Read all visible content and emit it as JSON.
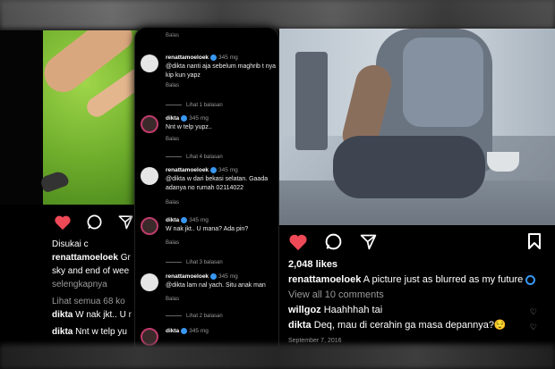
{
  "left_post": {
    "likes_prefix": "Disukai c",
    "caption_user": "renattamoeloek",
    "caption_text": "Gr",
    "caption_line2": "sky and end of wee",
    "caption_line3": "selengkapnya",
    "view_all": "Lihat semua 68 ko",
    "comments": [
      {
        "user": "dikta",
        "text": "W nak jkt.. U r"
      },
      {
        "user": "dikta",
        "text": "Nnt w telp yu"
      }
    ]
  },
  "comment_thread": {
    "top_reply": "Balas",
    "items": [
      {
        "user": "renattamoeloek",
        "time": "345 mg",
        "text": "@dikta nanti aja sebelum maghrib t nya kip kun yapz",
        "reply": "Balas",
        "avatar": "light"
      },
      {
        "user": "dikta",
        "time": "345 mg",
        "text": "Nnt w telp yupz..",
        "reply": "Balas",
        "avatar": "ring"
      },
      {
        "user": "renattamoeloek",
        "time": "345 mg",
        "text": "@dikta w dari bekasi selatan. Gaada adanya no rumah 02114022",
        "reply": "Balas",
        "avatar": "light"
      },
      {
        "user": "dikta",
        "time": "345 mg",
        "text": "W nak jkt.. U mana? Ada pin?",
        "reply": "Balas",
        "avatar": "ring"
      },
      {
        "user": "renattamoeloek",
        "time": "345 mg",
        "text": "@dikta lam nal yach. Situ anak man",
        "reply": "Balas",
        "avatar": "light"
      },
      {
        "user": "dikta",
        "time": "345 mg",
        "text": "",
        "reply": "",
        "avatar": "ring"
      }
    ],
    "more_replies": [
      "Lihat 1 balasan",
      "Lihat 4 balasan",
      "Lihat 3 balasan",
      "Lihat 2 balasan"
    ]
  },
  "right_post": {
    "likes": "2,048 likes",
    "caption_user": "renattamoeloek",
    "caption_text": "A picture just as blurred as my future",
    "view_all": "View all 10 comments",
    "comments": [
      {
        "user": "willgoz",
        "text": "Haahhhah tai"
      },
      {
        "user": "dikta",
        "text": "Deq, mau di cerahin ga masa depannya?😌"
      }
    ],
    "date": "September 7, 2016"
  },
  "icons": {
    "heart": "heart-icon",
    "comment": "comment-icon",
    "share": "share-icon",
    "bookmark": "bookmark-icon",
    "verified": "verified-badge-icon"
  },
  "colors": {
    "like_red": "#ed4956",
    "verified_blue": "#3897f0"
  }
}
